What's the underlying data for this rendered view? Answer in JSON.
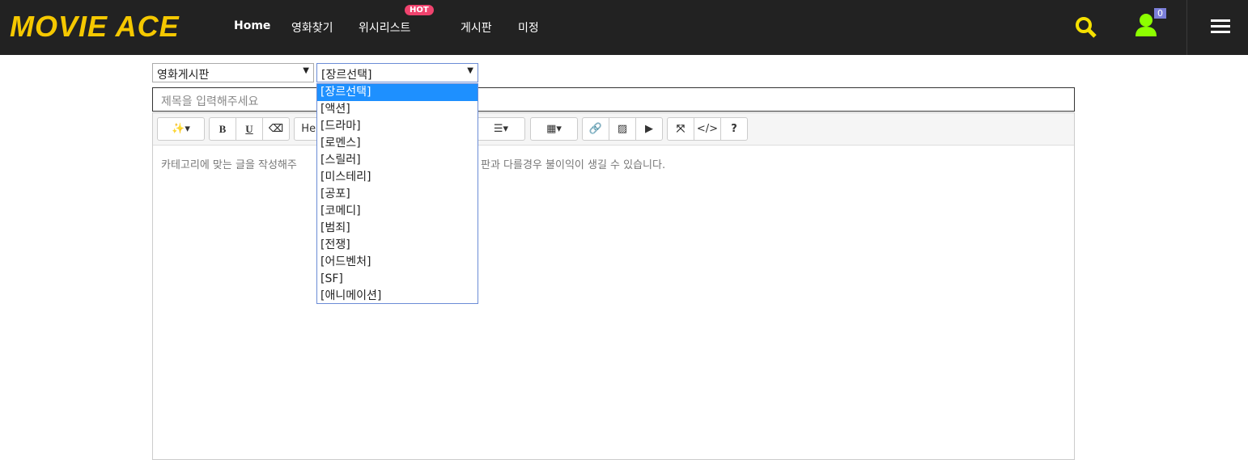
{
  "header": {
    "logo": "MOVIE ACE",
    "nav": [
      "Home",
      "영화찾기",
      "위시리스트",
      "게시판",
      "미정"
    ],
    "hot_badge": "HOT",
    "cart_count": "0"
  },
  "form": {
    "board_select": "영화게시판",
    "genre_select": "[장르선택]",
    "title_placeholder": "제목을 입력해주세요",
    "content_placeholder_visible": [
      "카테고리에 맞는 글을 작성해주",
      "판과 다를경우 불이익이 생길 수 있습니다."
    ]
  },
  "toolbar": {
    "font": "Hel",
    "bold": "B",
    "underline": "U",
    "codeview": "</>",
    "help": "?"
  },
  "genre_options": [
    "[장르선택]",
    "[액션]",
    "[드라마]",
    "[로멘스]",
    "[스릴러]",
    "[미스테리]",
    "[공포]",
    "[코메디]",
    "[범죄]",
    "[전쟁]",
    "[어드벤처]",
    "[SF]",
    "[애니메이션]"
  ]
}
